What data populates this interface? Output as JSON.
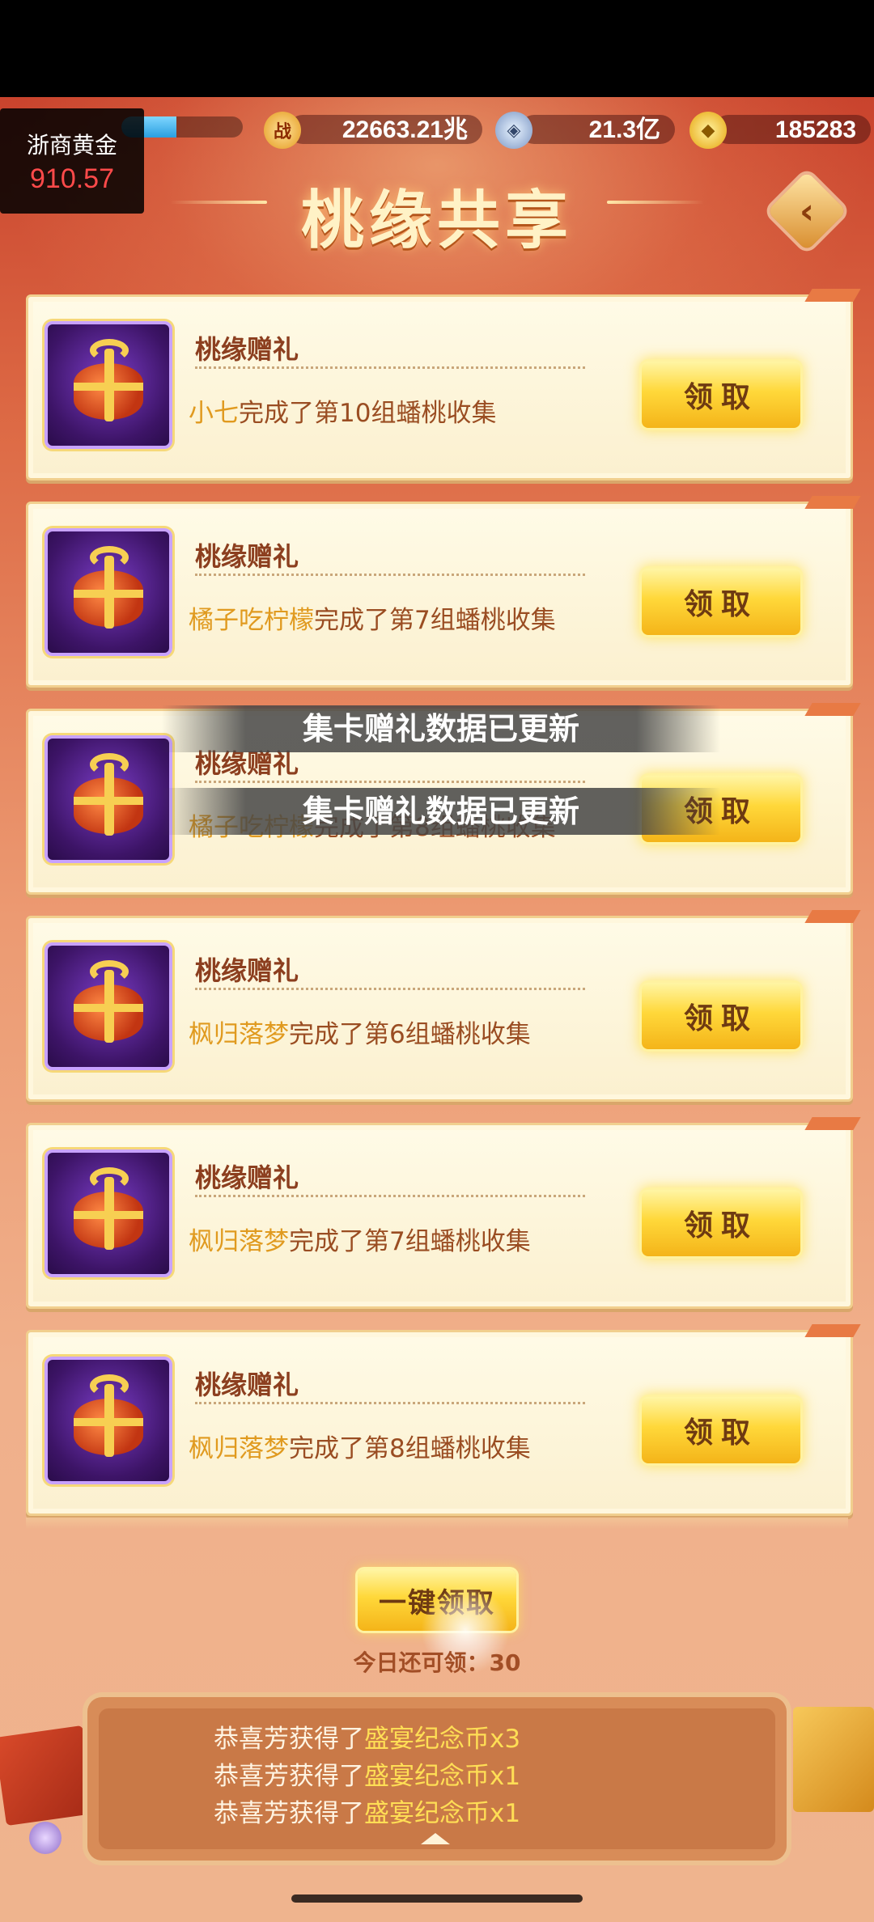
{
  "resources": {
    "battle_power": "22663.21兆",
    "coins": "21.3亿",
    "gold": "185283",
    "exp_progress": 0.45
  },
  "stock_overlay": {
    "name": "浙商黄金",
    "price": "910.57"
  },
  "page": {
    "title": "桃缘共享"
  },
  "cards": [
    {
      "title": "桃缘赠礼",
      "name": "小七",
      "text": "完成了第10组蟠桃收集",
      "button": "领取"
    },
    {
      "title": "桃缘赠礼",
      "name": "橘子吃柠檬",
      "text": "完成了第7组蟠桃收集",
      "button": "领取"
    },
    {
      "title": "桃缘赠礼",
      "name": "橘子吃柠檬",
      "text": "完成了第8组蟠桃收集",
      "button": "领取"
    },
    {
      "title": "桃缘赠礼",
      "name": "枫归落梦",
      "text": "完成了第6组蟠桃收集",
      "button": "领取"
    },
    {
      "title": "桃缘赠礼",
      "name": "枫归落梦",
      "text": "完成了第7组蟠桃收集",
      "button": "领取"
    },
    {
      "title": "桃缘赠礼",
      "name": "枫归落梦",
      "text": "完成了第8组蟠桃收集",
      "button": "领取"
    }
  ],
  "toasts": [
    "集卡赠礼数据已更新",
    "集卡赠礼数据已更新"
  ],
  "footer": {
    "one_key_button": "一键领取",
    "today_text": "今日还可领：30"
  },
  "log": [
    {
      "prefix": "恭喜芳获得了",
      "item": "盛宴纪念币x3"
    },
    {
      "prefix": "恭喜芳获得了",
      "item": "盛宴纪念币x1"
    },
    {
      "prefix": "恭喜芳获得了",
      "item": "盛宴纪念币x1"
    }
  ]
}
